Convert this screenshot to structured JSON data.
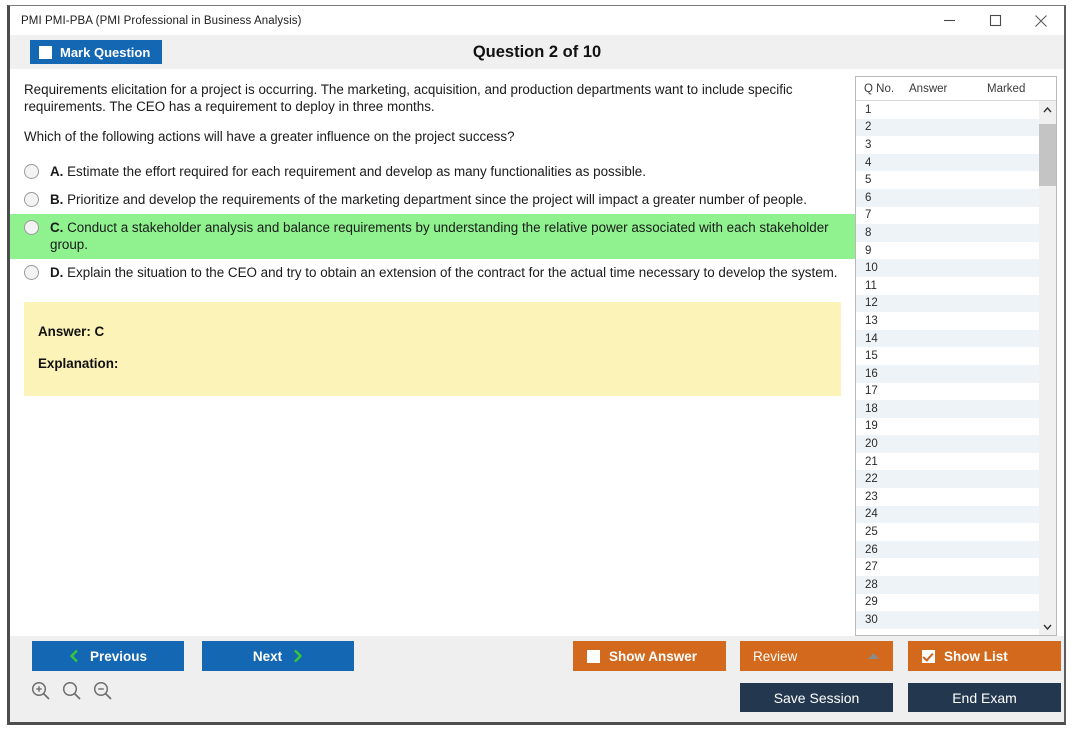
{
  "window": {
    "title": "PMI PMI-PBA (PMI Professional in Business Analysis)",
    "controls": {
      "minimize": "minimize-icon",
      "maximize": "maximize-icon",
      "close": "close-icon"
    }
  },
  "header": {
    "mark_question_label": "Mark Question",
    "mark_question_checked": false,
    "question_counter": "Question 2 of 10"
  },
  "question": {
    "stem_paragraph_1": "Requirements elicitation for a project is occurring. The marketing, acquisition, and production departments want to include specific requirements. The CEO has a requirement to deploy in three months.",
    "stem_paragraph_2": "Which of the following actions will have a greater influence on the project success?",
    "options": [
      {
        "letter": "A.",
        "text": "Estimate the effort required for each requirement and develop as many functionalities as possible.",
        "selected": false,
        "correct": false
      },
      {
        "letter": "B.",
        "text": "Prioritize and develop the requirements of the marketing department since the project will impact a greater number of people.",
        "selected": false,
        "correct": false
      },
      {
        "letter": "C.",
        "text": "Conduct a stakeholder analysis and balance requirements by understanding the relative power associated with each stakeholder group.",
        "selected": false,
        "correct": true
      },
      {
        "letter": "D.",
        "text": "Explain the situation to the CEO and try to obtain an extension of the contract for the actual time necessary to develop the system.",
        "selected": false,
        "correct": false
      }
    ]
  },
  "answer_panel": {
    "answer_label": "Answer: C",
    "explanation_label": "Explanation:"
  },
  "question_list": {
    "columns": [
      "Q No.",
      "Answer",
      "Marked"
    ],
    "rows": [
      {
        "qno": "1",
        "answer": "",
        "marked": ""
      },
      {
        "qno": "2",
        "answer": "",
        "marked": ""
      },
      {
        "qno": "3",
        "answer": "",
        "marked": ""
      },
      {
        "qno": "4",
        "answer": "",
        "marked": ""
      },
      {
        "qno": "5",
        "answer": "",
        "marked": ""
      },
      {
        "qno": "6",
        "answer": "",
        "marked": ""
      },
      {
        "qno": "7",
        "answer": "",
        "marked": ""
      },
      {
        "qno": "8",
        "answer": "",
        "marked": ""
      },
      {
        "qno": "9",
        "answer": "",
        "marked": ""
      },
      {
        "qno": "10",
        "answer": "",
        "marked": ""
      },
      {
        "qno": "11",
        "answer": "",
        "marked": ""
      },
      {
        "qno": "12",
        "answer": "",
        "marked": ""
      },
      {
        "qno": "13",
        "answer": "",
        "marked": ""
      },
      {
        "qno": "14",
        "answer": "",
        "marked": ""
      },
      {
        "qno": "15",
        "answer": "",
        "marked": ""
      },
      {
        "qno": "16",
        "answer": "",
        "marked": ""
      },
      {
        "qno": "17",
        "answer": "",
        "marked": ""
      },
      {
        "qno": "18",
        "answer": "",
        "marked": ""
      },
      {
        "qno": "19",
        "answer": "",
        "marked": ""
      },
      {
        "qno": "20",
        "answer": "",
        "marked": ""
      },
      {
        "qno": "21",
        "answer": "",
        "marked": ""
      },
      {
        "qno": "22",
        "answer": "",
        "marked": ""
      },
      {
        "qno": "23",
        "answer": "",
        "marked": ""
      },
      {
        "qno": "24",
        "answer": "",
        "marked": ""
      },
      {
        "qno": "25",
        "answer": "",
        "marked": ""
      },
      {
        "qno": "26",
        "answer": "",
        "marked": ""
      },
      {
        "qno": "27",
        "answer": "",
        "marked": ""
      },
      {
        "qno": "28",
        "answer": "",
        "marked": ""
      },
      {
        "qno": "29",
        "answer": "",
        "marked": ""
      },
      {
        "qno": "30",
        "answer": "",
        "marked": ""
      }
    ],
    "scrollbar": {
      "up_arrow": "chevron-up-icon",
      "down_arrow": "chevron-down-icon"
    }
  },
  "footer": {
    "previous_label": "Previous",
    "next_label": "Next",
    "show_answer_label": "Show Answer",
    "show_answer_checked": false,
    "review_label": "Review",
    "review_caret": "caret-up-icon",
    "show_list_label": "Show List",
    "show_list_checked": true,
    "save_session_label": "Save Session",
    "end_exam_label": "End Exam",
    "zoom_in": "zoom-in-icon",
    "zoom_reset": "zoom-reset-icon",
    "zoom_out": "zoom-out-icon"
  },
  "colors": {
    "primary_blue": "#1367b3",
    "orange": "#d3691c",
    "navy": "#23384f",
    "correct_green": "#8ff28f",
    "answer_yellow": "#fcf3b8",
    "arrow_green": "#37c837",
    "row_alt": "#eef3f8"
  }
}
